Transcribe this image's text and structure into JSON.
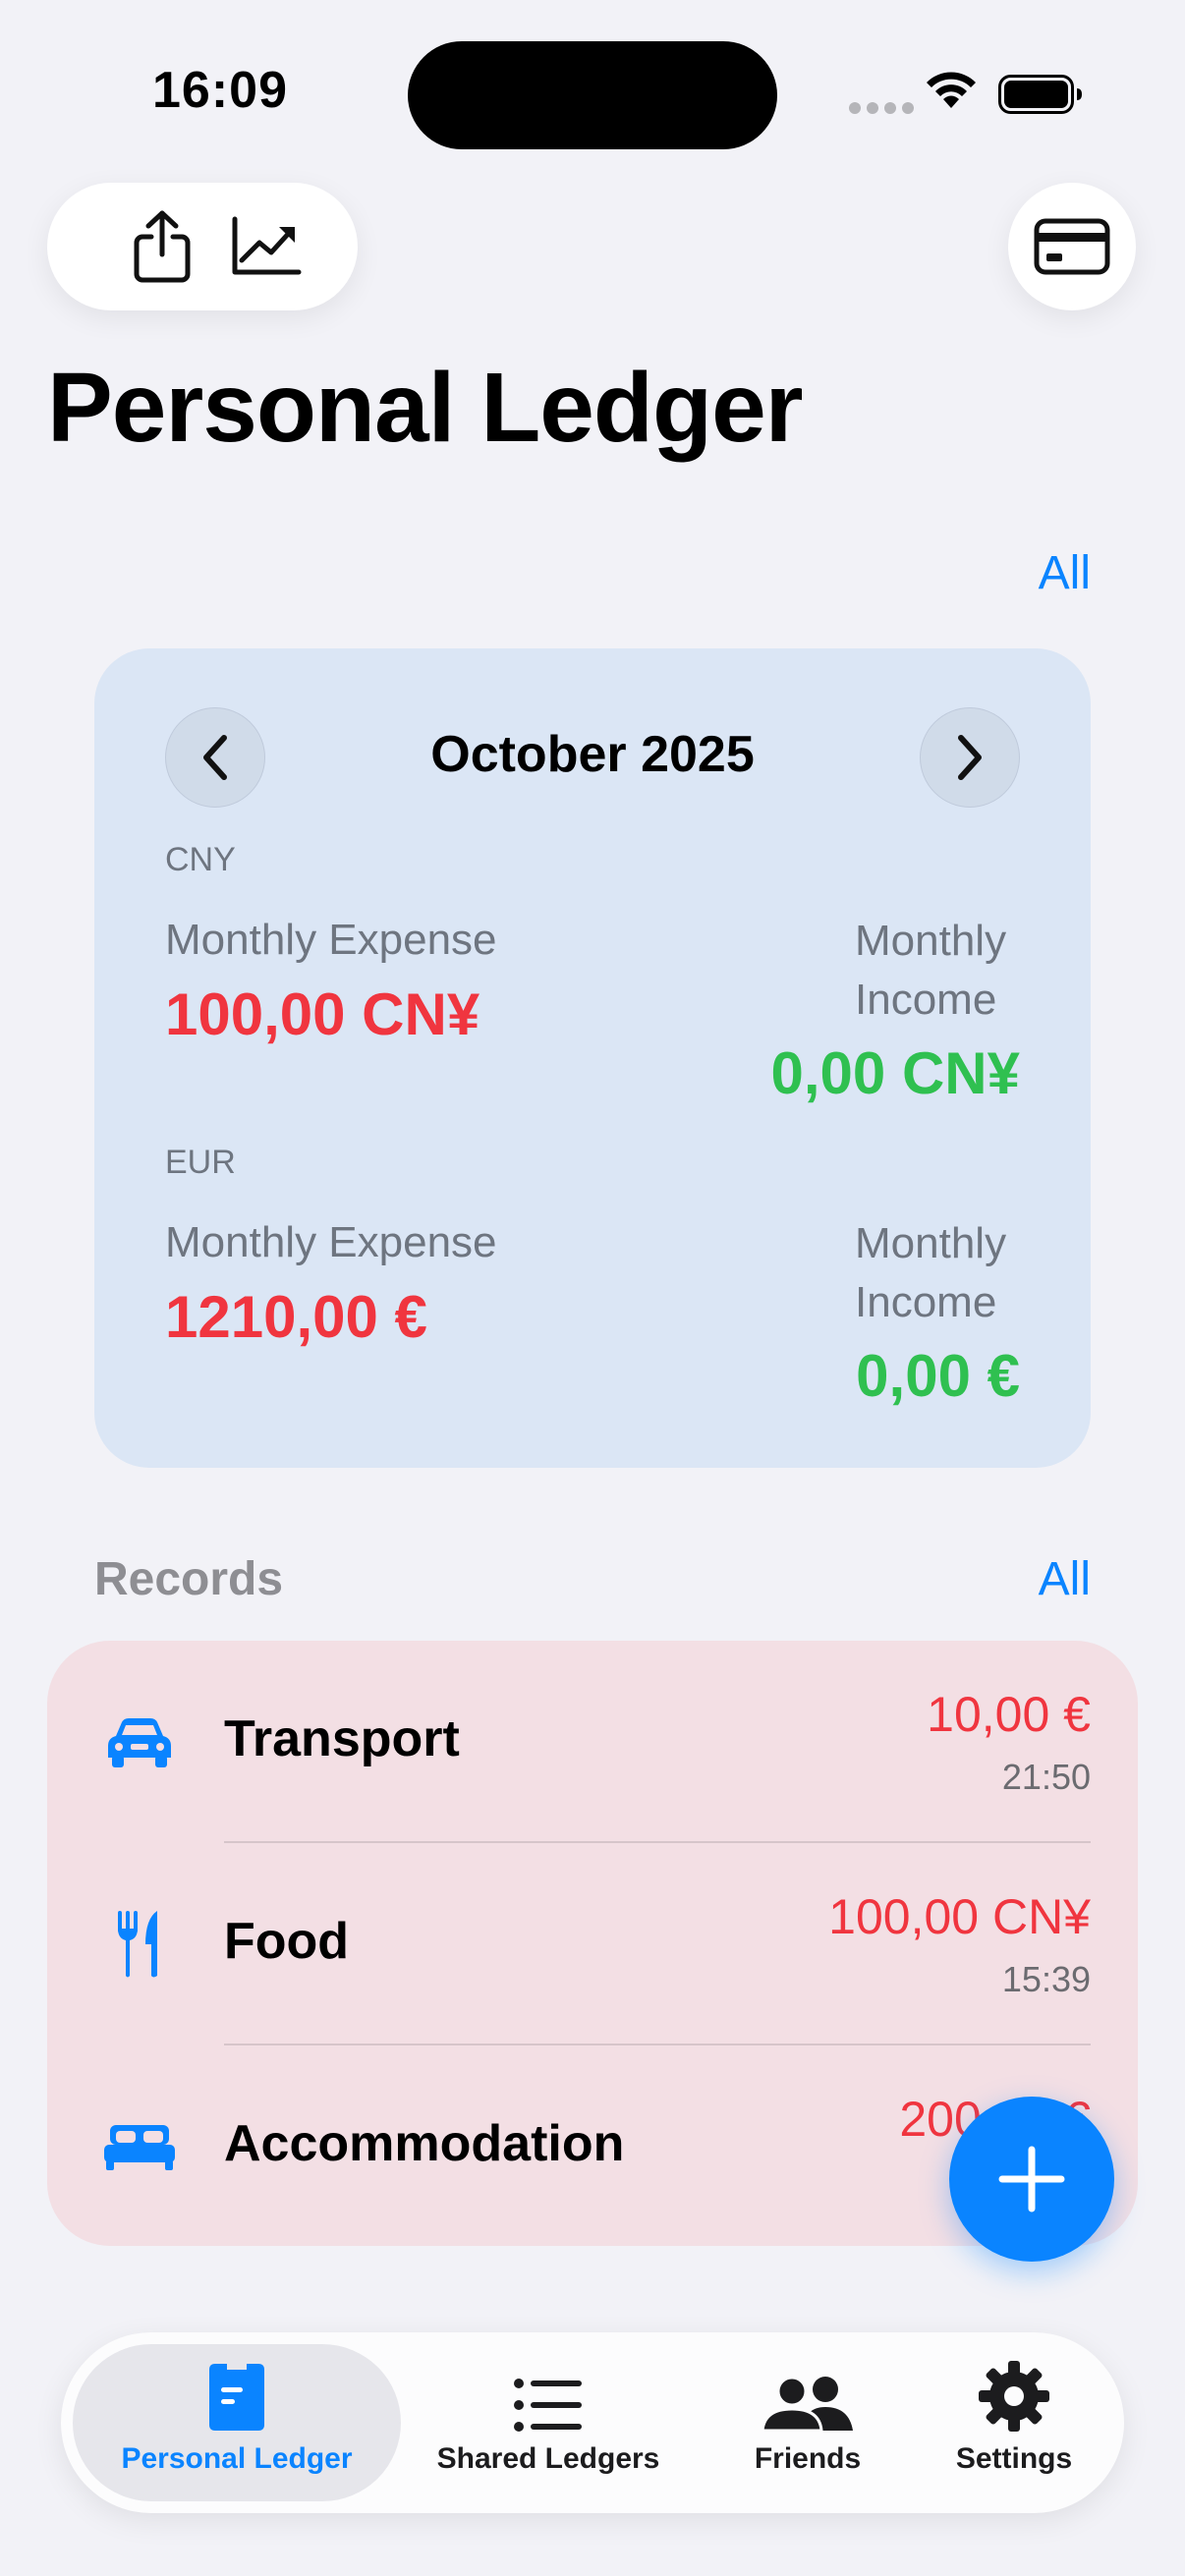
{
  "status_bar": {
    "time": "16:09"
  },
  "header": {
    "title": "Personal Ledger",
    "all_link": "All"
  },
  "summary": {
    "month": "October 2025",
    "currencies": [
      {
        "code": "CNY",
        "expense_label": "Monthly Expense",
        "expense": "100,00 CN¥",
        "income_label": "Monthly Income",
        "income": "0,00 CN¥"
      },
      {
        "code": "EUR",
        "expense_label": "Monthly Expense",
        "expense": "1210,00 €",
        "income_label": "Monthly Income",
        "income": "0,00 €"
      }
    ],
    "colors": {
      "card": "#dbe6f5",
      "expense": "#f0353f",
      "income": "#2fc050"
    }
  },
  "records": {
    "heading": "Records",
    "all_link": "All",
    "items": [
      {
        "icon": "car-icon",
        "name": "Transport",
        "amount": "10,00 €",
        "time": "21:50"
      },
      {
        "icon": "fork-knife-icon",
        "name": "Food",
        "amount": "100,00 CN¥",
        "time": "15:39"
      },
      {
        "icon": "bed-icon",
        "name": "Accommodation",
        "amount": "200,00 €",
        "time": ""
      }
    ]
  },
  "tabs": [
    {
      "label": "Personal Ledger",
      "icon": "ledger-icon",
      "active": true
    },
    {
      "label": "Shared Ledgers",
      "icon": "list-icon",
      "active": false
    },
    {
      "label": "Friends",
      "icon": "people-icon",
      "active": false
    },
    {
      "label": "Settings",
      "icon": "gear-icon",
      "active": false
    }
  ],
  "accent_color": "#0a84ff"
}
